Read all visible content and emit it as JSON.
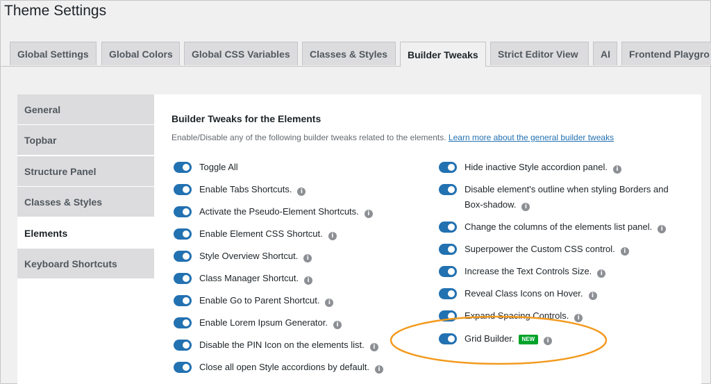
{
  "page": {
    "title": "Theme Settings"
  },
  "tabs": [
    {
      "label": "Global Settings",
      "active": false
    },
    {
      "label": "Global Colors",
      "active": false
    },
    {
      "label": "Global CSS Variables",
      "active": false
    },
    {
      "label": "Classes & Styles",
      "active": false
    },
    {
      "label": "Builder Tweaks",
      "active": true
    },
    {
      "label": "Strict Editor View",
      "active": false
    },
    {
      "label": "AI",
      "active": false
    },
    {
      "label": "Frontend Playgro",
      "active": false
    }
  ],
  "sidebar": {
    "items": [
      {
        "label": "General",
        "active": false
      },
      {
        "label": "Topbar",
        "active": false
      },
      {
        "label": "Structure Panel",
        "active": false
      },
      {
        "label": "Classes & Styles",
        "active": false
      },
      {
        "label": "Elements",
        "active": true
      },
      {
        "label": "Keyboard Shortcuts",
        "active": false
      }
    ]
  },
  "section": {
    "title": "Builder Tweaks for the Elements",
    "description": "Enable/Disable any of the following builder tweaks related to the elements.",
    "link_text": "Learn more about the general builder tweaks"
  },
  "options_left": [
    {
      "label": "Toggle All",
      "info": false,
      "on": true
    },
    {
      "label": "Enable Tabs Shortcuts.",
      "info": true,
      "on": true
    },
    {
      "label": "Activate the Pseudo-Element Shortcuts.",
      "info": true,
      "on": true
    },
    {
      "label": "Enable Element CSS Shortcut.",
      "info": true,
      "on": true
    },
    {
      "label": "Style Overview Shortcut.",
      "info": true,
      "on": true
    },
    {
      "label": "Class Manager Shortcut.",
      "info": true,
      "on": true
    },
    {
      "label": "Enable Go to Parent Shortcut.",
      "info": true,
      "on": true
    },
    {
      "label": "Enable Lorem Ipsum Generator.",
      "info": true,
      "on": true
    },
    {
      "label": "Disable the PIN Icon on the elements list.",
      "info": true,
      "on": true
    },
    {
      "label": "Close all open Style accordions by default.",
      "info": true,
      "on": true
    }
  ],
  "options_right": [
    {
      "label": "Hide inactive Style accordion panel.",
      "info": true,
      "on": true
    },
    {
      "label": "Disable element's outline when styling Borders and Box-shadow.",
      "info": true,
      "on": true
    },
    {
      "label": "Change the columns of the elements list panel.",
      "info": true,
      "on": true
    },
    {
      "label": "Superpower the Custom CSS control.",
      "info": true,
      "on": true
    },
    {
      "label": "Increase the Text Controls Size.",
      "info": true,
      "on": true
    },
    {
      "label": "Reveal Class Icons on Hover.",
      "info": true,
      "on": true
    },
    {
      "label": "Expand Spacing Controls.",
      "info": true,
      "on": true
    },
    {
      "label": "Grid Builder.",
      "info": true,
      "on": true,
      "badge": "NEW"
    }
  ],
  "info_glyph": "i",
  "colors": {
    "toggle_on": "#2271b1",
    "link": "#2271b1",
    "badge": "#00a32a",
    "highlight": "#f39a1e"
  }
}
